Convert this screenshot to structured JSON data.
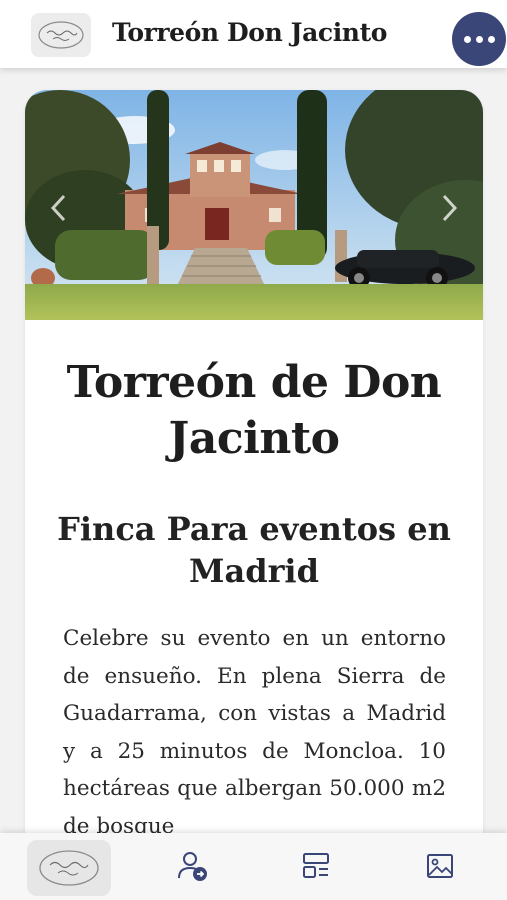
{
  "header": {
    "logo_icon": "torreon-logo-icon",
    "title": "Torreón Don Jacinto",
    "menu_icon": "more-dots-icon",
    "accent_color": "#3a4578"
  },
  "hero": {
    "image": "estate-tower-garden-classic-car-photo",
    "prev_icon": "chevron-left-icon",
    "next_icon": "chevron-right-icon"
  },
  "content": {
    "title": "Torreón de Don Jacinto",
    "subtitle": "Finca Para eventos en Madrid",
    "body": "Celebre su evento en un entorno de ensueño. En plena Sierra de Guadarrama, con vistas a Madrid y a 25 minutos de Moncloa. 10 hectáreas que albergan 50.000 m2 de bosque"
  },
  "bottom_nav": {
    "items": [
      {
        "icon": "torreon-logo-icon"
      },
      {
        "icon": "user-contact-icon"
      },
      {
        "icon": "layout-list-icon"
      },
      {
        "icon": "image-gallery-icon"
      }
    ],
    "icon_color": "#3a4578"
  }
}
